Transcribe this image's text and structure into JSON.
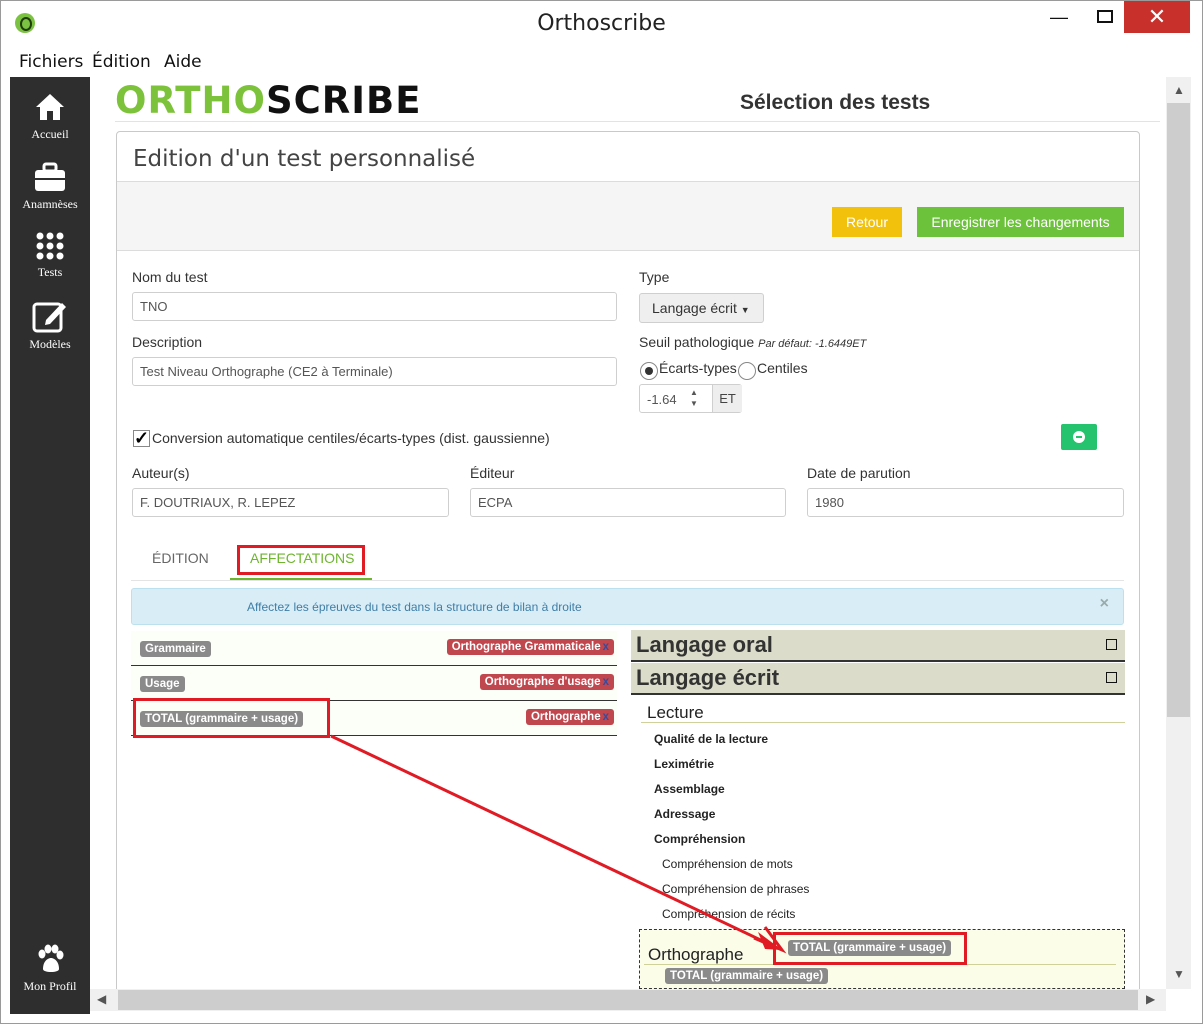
{
  "window": {
    "title": "Orthoscribe"
  },
  "menu": [
    "Fichiers",
    "Édition",
    "Aide"
  ],
  "sidebar": [
    {
      "label": "Accueil",
      "icon": "home-icon"
    },
    {
      "label": "Anamnèses",
      "icon": "briefcase-icon"
    },
    {
      "label": "Tests",
      "icon": "grid-icon"
    },
    {
      "label": "Modèles",
      "icon": "edit-icon"
    },
    {
      "label": "Mon Profil",
      "icon": "paw-icon"
    }
  ],
  "logo": {
    "part1": "ORTHO",
    "part2": "SCRIBE"
  },
  "page_heading": "Sélection des tests",
  "panel_title": "Edition d'un test personnalisé",
  "buttons": {
    "back": "Retour",
    "save": "Enregistrer les changements"
  },
  "form": {
    "name_label": "Nom du test",
    "name_value": "TNO",
    "description_label": "Description",
    "description_value": "Test Niveau Orthographe (CE2 à Terminale)",
    "type_label": "Type",
    "type_value": "Langage écrit",
    "threshold_label": "Seuil pathologique",
    "threshold_hint": "Par défaut: -1.6449ET",
    "radio_std": "Écarts-types",
    "radio_centiles": "Centiles",
    "threshold_value": "-1.64",
    "threshold_unit": "ET",
    "conversion_label": "Conversion automatique centiles/écarts-types (dist. gaussienne)",
    "authors_label": "Auteur(s)",
    "authors_value": "F. DOUTRIAUX, R. LEPEZ",
    "editor_label": "Éditeur",
    "editor_value": "ECPA",
    "date_label": "Date de parution",
    "date_value": "1980"
  },
  "tabs": {
    "edition": "ÉDITION",
    "affectations": "AFFECTATIONS"
  },
  "alert": {
    "text": "Affectez les épreuves du test dans la structure de bilan à droite",
    "close": "×"
  },
  "epreuves": [
    {
      "name": "Grammaire",
      "assigned": "Orthographe Grammaticale"
    },
    {
      "name": "Usage",
      "assigned": "Orthographe d'usage"
    },
    {
      "name": "TOTAL (grammaire + usage)",
      "assigned": "Orthographe"
    }
  ],
  "remove_mark": "x",
  "tree": {
    "cat_oral": "Langage oral",
    "cat_ecrit": "Langage écrit",
    "sub_lecture": "Lecture",
    "lecture_items": [
      "Qualité de la lecture",
      "Leximétrie",
      "Assemblage",
      "Adressage",
      "Compréhension"
    ],
    "comprehension_items": [
      "Compréhension de mots",
      "Compréhension de phrases",
      "Compréhension de récits"
    ],
    "sub_orthographe": "Orthographe",
    "dragged_tag": "TOTAL (grammaire + usage)",
    "orthographe_tag": "TOTAL (grammaire + usage)"
  },
  "colors": {
    "accent_green": "#6cc23a",
    "back_yellow": "#f2c10c",
    "annotation_red": "#e01b24",
    "sidebar_bg": "#2e2e2e"
  }
}
